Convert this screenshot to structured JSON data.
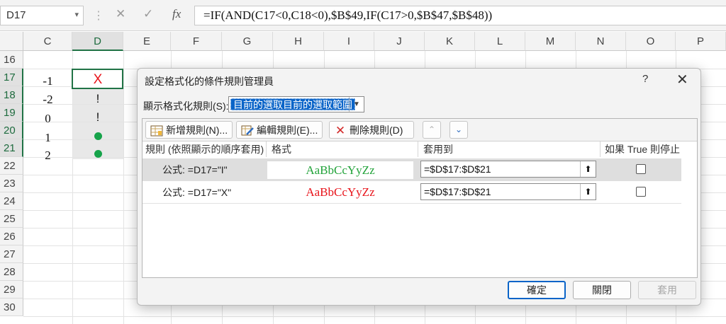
{
  "formula_bar": {
    "name_box": "D17",
    "cancel_glyph": "✕",
    "enter_glyph": "✓",
    "fx_label": "fx",
    "formula": "=IF(AND(C17<0,C18<0),$B$49,IF(C17>0,$B$47,$B$48))"
  },
  "columns": [
    "C",
    "D",
    "E",
    "F",
    "G",
    "H",
    "I",
    "J",
    "K",
    "L",
    "M",
    "N",
    "O",
    "P"
  ],
  "rows": [
    "16",
    "17",
    "18",
    "19",
    "20",
    "21",
    "22",
    "23",
    "24",
    "25",
    "26",
    "27",
    "28",
    "29",
    "30"
  ],
  "cells": {
    "c17": "-1",
    "c18": "-2",
    "c19": "0",
    "c20": "1",
    "c21": "2",
    "d17": "X",
    "d18": "!",
    "d19": "!"
  },
  "colors": {
    "excel_green": "#217346",
    "red_x": "#e8141b",
    "green_dot": "#16a34a",
    "preview_green": "#22a33a",
    "preview_red": "#e8141b",
    "selection_blue": "#0a64c8"
  },
  "dialog": {
    "title": "設定格式化的條件規則管理員",
    "help": "?",
    "close": "✕",
    "show_label": "顯示格式化規則(S):",
    "show_value": "目前的選取目前的選取範圍",
    "toolbar": {
      "new_rule": "新增規則(N)...",
      "edit_rule": "編輯規則(E)...",
      "delete_rule": "刪除規則(D)",
      "move_up": "⌃",
      "move_down": "⌄"
    },
    "headers": {
      "rule": "規則 (依照顯示的順序套用)",
      "format": "格式",
      "applies_to": "套用到",
      "stop_if_true": "如果 True 則停止"
    },
    "rules": [
      {
        "rule": "公式: =D17=\"I\"",
        "preview": "AaBbCcYyZz",
        "applies": "=$D$17:$D$21"
      },
      {
        "rule": "公式: =D17=\"X\"",
        "preview": "AaBbCcYyZz",
        "applies": "=$D$17:$D$21"
      }
    ],
    "buttons": {
      "ok": "確定",
      "close": "關閉",
      "apply": "套用"
    }
  }
}
